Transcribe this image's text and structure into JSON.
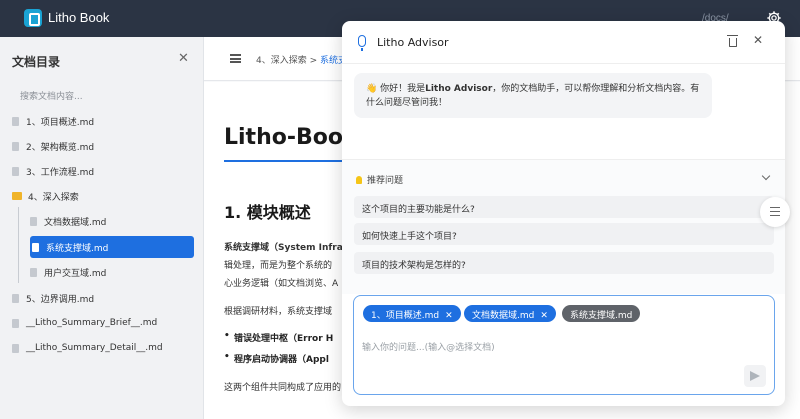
{
  "app": {
    "brand": "Litho Book",
    "docs_link": "/docs/"
  },
  "sidebar": {
    "title": "文档目录",
    "search_placeholder": "搜索文档内容...",
    "items": [
      {
        "label": "1、项目概述.md"
      },
      {
        "label": "2、架构概览.md"
      },
      {
        "label": "3、工作流程.md"
      },
      {
        "label": "4、深入探索"
      },
      {
        "label": "文档数据域.md"
      },
      {
        "label": "系统支撑域.md"
      },
      {
        "label": "用户交互域.md"
      },
      {
        "label": "5、边界调用.md"
      },
      {
        "label": "__Litho_Summary_Brief__.md"
      },
      {
        "label": "__Litho_Summary_Detail__.md"
      }
    ]
  },
  "main": {
    "breadcrumb_parent": "4、深入探索 >",
    "breadcrumb_current": "系统支",
    "title": "Litho-Book",
    "h2": "1. 模块概述",
    "p1_bold": "系统支撑域（System Infra",
    "p1_line2": "辑处理，而是为整个系统的",
    "p1_line3": "心业务逻辑（如文档浏览、A",
    "p2": "根据调研材料，系统支撑域",
    "bullet1": "错误处理中枢（Error H",
    "bullet2": "程序启动协调器（Appl",
    "p3": "这两个组件共同构成了应用的"
  },
  "advisor": {
    "title": "Litho Advisor",
    "message_prefix": "👋 你好！我是",
    "message_name": "Litho Advisor",
    "message_suffix": "，你的文档助手，可以帮你理解和分析文档内容。有什么问题尽管问我！",
    "suggestions_title": "推荐问题",
    "suggestions": [
      "这个项目的主要功能是什么?",
      "如何快速上手这个项目?",
      "项目的技术架构是怎样的?"
    ],
    "chips": [
      {
        "label": "1、项目概述.md",
        "removable": "✕"
      },
      {
        "label": "文档数据域.md",
        "removable": "✕"
      },
      {
        "label": "系统支撑域.md"
      }
    ],
    "input_placeholder": "输入你的问题...(输入@选择文档)"
  }
}
